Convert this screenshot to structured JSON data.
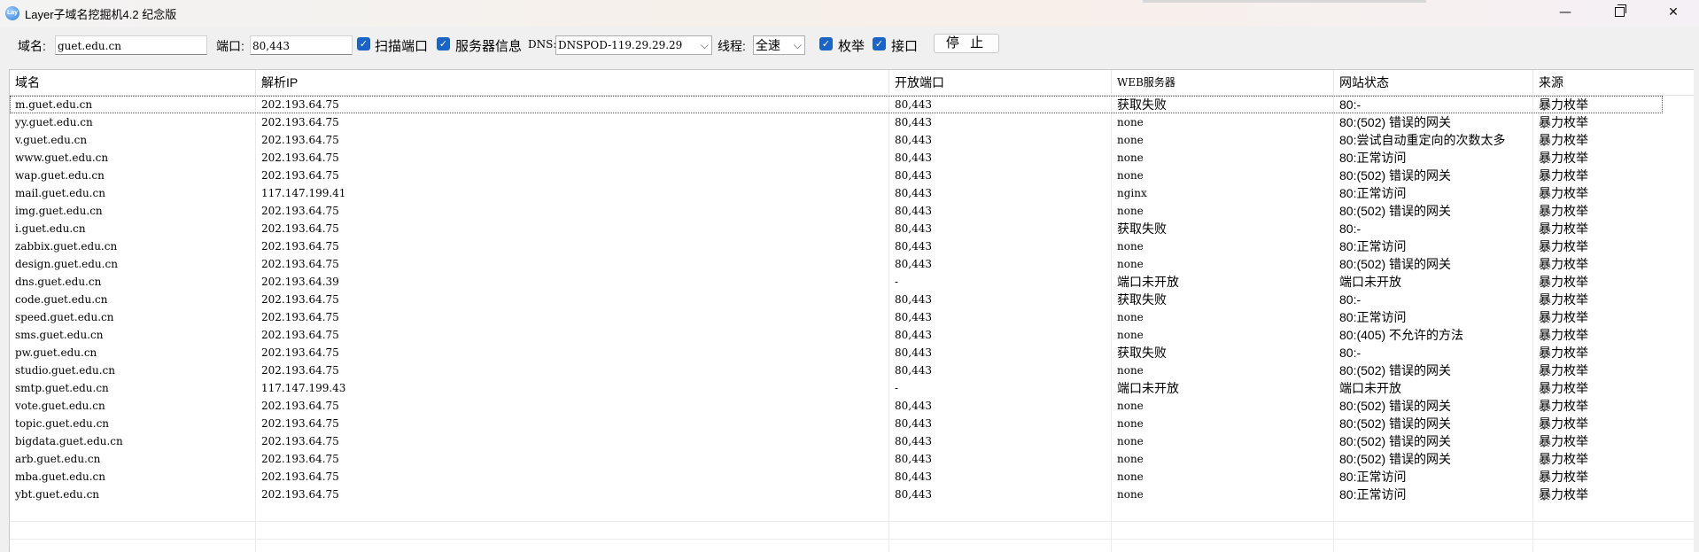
{
  "window": {
    "title": "Layer子域名挖掘机4.2 纪念版",
    "icon_text": "Lay",
    "minimize_glyph": "—",
    "close_glyph": "✕"
  },
  "toolbar": {
    "domain_label": "域名:",
    "domain_value": "guet.edu.cn",
    "port_label": "端口:",
    "port_value": "80,443",
    "scan_port": {
      "label": "扫描端口",
      "checked": true
    },
    "server_info": {
      "label": "服务器信息",
      "checked": true
    },
    "dns_label": "DNS:",
    "dns_value": "DNSPOD-119.29.29.29",
    "thread_label": "线程:",
    "thread_value": "全速",
    "enumerate": {
      "label": "枚举",
      "checked": true
    },
    "api": {
      "label": "接口",
      "checked": true
    },
    "stop_label": "停 止"
  },
  "table": {
    "columns": [
      "域名",
      "解析IP",
      "开放端口",
      "WEB服务器",
      "网站状态",
      "来源"
    ],
    "rows": [
      [
        "m.guet.edu.cn",
        "202.193.64.75",
        "80,443",
        "获取失败",
        "80:-",
        "暴力枚举"
      ],
      [
        "yy.guet.edu.cn",
        "202.193.64.75",
        "80,443",
        "none",
        "80:(502) 错误的网关",
        "暴力枚举"
      ],
      [
        "v.guet.edu.cn",
        "202.193.64.75",
        "80,443",
        "none",
        "80:尝试自动重定向的次数太多",
        "暴力枚举"
      ],
      [
        "www.guet.edu.cn",
        "202.193.64.75",
        "80,443",
        "none",
        "80:正常访问",
        "暴力枚举"
      ],
      [
        "wap.guet.edu.cn",
        "202.193.64.75",
        "80,443",
        "none",
        "80:(502) 错误的网关",
        "暴力枚举"
      ],
      [
        "mail.guet.edu.cn",
        "117.147.199.41",
        "80,443",
        "nginx",
        "80:正常访问",
        "暴力枚举"
      ],
      [
        "img.guet.edu.cn",
        "202.193.64.75",
        "80,443",
        "none",
        "80:(502) 错误的网关",
        "暴力枚举"
      ],
      [
        "i.guet.edu.cn",
        "202.193.64.75",
        "80,443",
        "获取失败",
        "80:-",
        "暴力枚举"
      ],
      [
        "zabbix.guet.edu.cn",
        "202.193.64.75",
        "80,443",
        "none",
        "80:正常访问",
        "暴力枚举"
      ],
      [
        "design.guet.edu.cn",
        "202.193.64.75",
        "80,443",
        "none",
        "80:(502) 错误的网关",
        "暴力枚举"
      ],
      [
        "dns.guet.edu.cn",
        "202.193.64.39",
        "-",
        "端口未开放",
        "端口未开放",
        "暴力枚举"
      ],
      [
        "code.guet.edu.cn",
        "202.193.64.75",
        "80,443",
        "获取失败",
        "80:-",
        "暴力枚举"
      ],
      [
        "speed.guet.edu.cn",
        "202.193.64.75",
        "80,443",
        "none",
        "80:正常访问",
        "暴力枚举"
      ],
      [
        "sms.guet.edu.cn",
        "202.193.64.75",
        "80,443",
        "none",
        "80:(405) 不允许的方法",
        "暴力枚举"
      ],
      [
        "pw.guet.edu.cn",
        "202.193.64.75",
        "80,443",
        "获取失败",
        "80:-",
        "暴力枚举"
      ],
      [
        "studio.guet.edu.cn",
        "202.193.64.75",
        "80,443",
        "none",
        "80:(502) 错误的网关",
        "暴力枚举"
      ],
      [
        "smtp.guet.edu.cn",
        "117.147.199.43",
        "-",
        "端口未开放",
        "端口未开放",
        "暴力枚举"
      ],
      [
        "vote.guet.edu.cn",
        "202.193.64.75",
        "80,443",
        "none",
        "80:(502) 错误的网关",
        "暴力枚举"
      ],
      [
        "topic.guet.edu.cn",
        "202.193.64.75",
        "80,443",
        "none",
        "80:(502) 错误的网关",
        "暴力枚举"
      ],
      [
        "bigdata.guet.edu.cn",
        "202.193.64.75",
        "80,443",
        "none",
        "80:(502) 错误的网关",
        "暴力枚举"
      ],
      [
        "arb.guet.edu.cn",
        "202.193.64.75",
        "80,443",
        "none",
        "80:(502) 错误的网关",
        "暴力枚举"
      ],
      [
        "mba.guet.edu.cn",
        "202.193.64.75",
        "80,443",
        "none",
        "80:正常访问",
        "暴力枚举"
      ],
      [
        "ybt.guet.edu.cn",
        "202.193.64.75",
        "80,443",
        "none",
        "80:正常访问",
        "暴力枚举"
      ]
    ]
  },
  "colors": {
    "checkbox": "#1a63c7",
    "grid_background": "#ffffff",
    "window_background": "#f0f0f0"
  }
}
